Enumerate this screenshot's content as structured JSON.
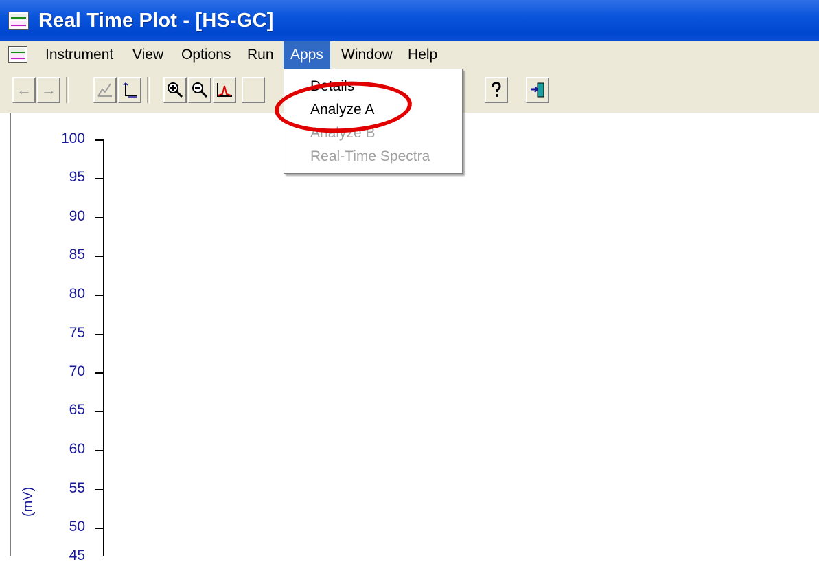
{
  "window": {
    "title": "Real Time Plot - [HS-GC]"
  },
  "menu": {
    "items": [
      "Instrument",
      "View",
      "Options",
      "Run",
      "Apps",
      "Window",
      "Help"
    ],
    "active": "Apps"
  },
  "apps_menu": {
    "items": [
      {
        "label": "Details",
        "enabled": true
      },
      {
        "label": "Analyze A",
        "enabled": true
      },
      {
        "label": "Analyze B",
        "enabled": false
      },
      {
        "label": "Real-Time Spectra",
        "enabled": false
      }
    ],
    "highlighted": "Analyze A",
    "highlight_color": "#e00000"
  },
  "toolbar": {
    "icons": [
      "back-arrow-icon",
      "forward-arrow-icon",
      "trace-icon",
      "axis-scale-icon",
      "zoom-in-icon",
      "zoom-out-icon",
      "autoscale-icon",
      "hidden-icon",
      "hidden-icon",
      "help-icon",
      "exit-icon"
    ]
  },
  "plot": {
    "y_ticks": [
      "100",
      "95",
      "90",
      "85",
      "80",
      "75",
      "70",
      "65",
      "60",
      "55",
      "50",
      "45"
    ],
    "y_unit": "(mV)",
    "axis_color": "#1a1a99"
  }
}
